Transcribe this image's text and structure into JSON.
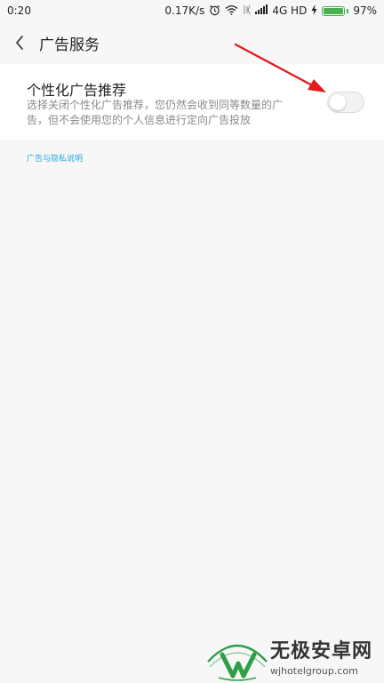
{
  "status_bar": {
    "time": "0:20",
    "speed": "0.17K/s",
    "network": "4G HD",
    "battery": "97%",
    "battery_level": 0.97,
    "icons": [
      "alarm-icon",
      "wifi-icon",
      "signal-icon",
      "charging-icon"
    ]
  },
  "header": {
    "title": "广告服务",
    "back_icon": "chevron-left-icon"
  },
  "setting": {
    "title": "个性化广告推荐",
    "description": "选择关闭个性化广告推荐，您仍然会收到同等数量的广告，但不会使用您的个人信息进行定向广告投放",
    "enabled": false
  },
  "privacy_link": "广告与隐私说明",
  "colors": {
    "accent_link": "#2aa6e0",
    "annotation_arrow": "#e21b1b",
    "battery": "#4caf50",
    "logo_green": "#2e9e47"
  },
  "watermark": {
    "title": "无极安卓网",
    "url": "wjhotelgroup.com"
  }
}
